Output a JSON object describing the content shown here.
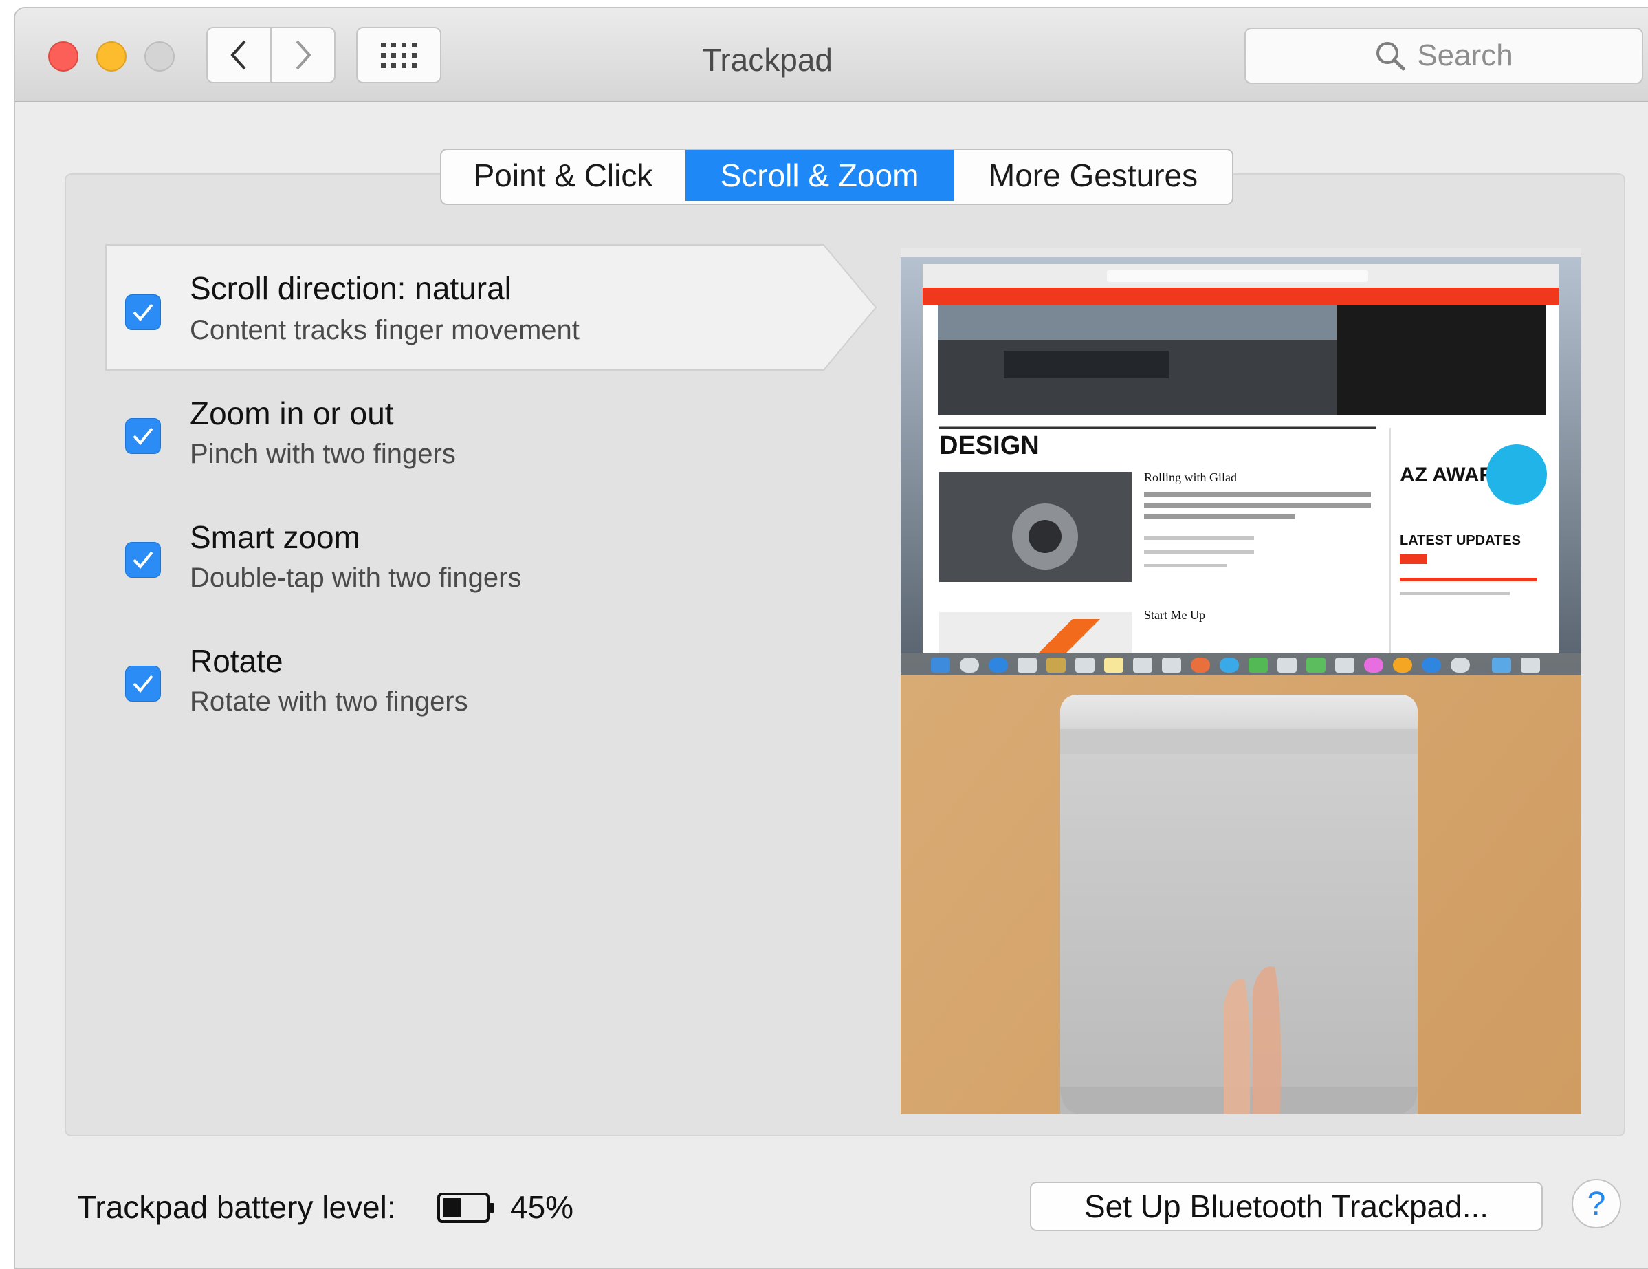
{
  "window": {
    "title": "Trackpad"
  },
  "search": {
    "placeholder": "Search"
  },
  "tabs": [
    {
      "label": "Point & Click",
      "selected": false
    },
    {
      "label": "Scroll & Zoom",
      "selected": true
    },
    {
      "label": "More Gestures",
      "selected": false
    }
  ],
  "options": [
    {
      "title": "Scroll direction: natural",
      "subtitle": "Content tracks finger movement",
      "checked": true,
      "highlighted": true
    },
    {
      "title": "Zoom in or out",
      "subtitle": "Pinch with two fingers",
      "checked": true,
      "highlighted": false
    },
    {
      "title": "Smart zoom",
      "subtitle": "Double-tap with two fingers",
      "checked": true,
      "highlighted": false
    },
    {
      "title": "Rotate",
      "subtitle": "Rotate with two fingers",
      "checked": true,
      "highlighted": false
    }
  ],
  "preview": {
    "section_heading": "DESIGN",
    "article_1_title": "Rolling with Gilad",
    "article_2_title": "Start Me Up",
    "awards_logo": "AZ AWARDS",
    "sidebar_heading": "LATEST UPDATES"
  },
  "footer": {
    "battery_label": "Trackpad battery level:",
    "battery_percent": "45%",
    "battery_level": 0.45,
    "setup_button": "Set Up Bluetooth Trackpad...",
    "help_label": "?"
  },
  "colors": {
    "accent": "#1e89f6",
    "close": "#fc5f57",
    "minimize": "#fdbc2e",
    "site_red": "#f0381c"
  }
}
